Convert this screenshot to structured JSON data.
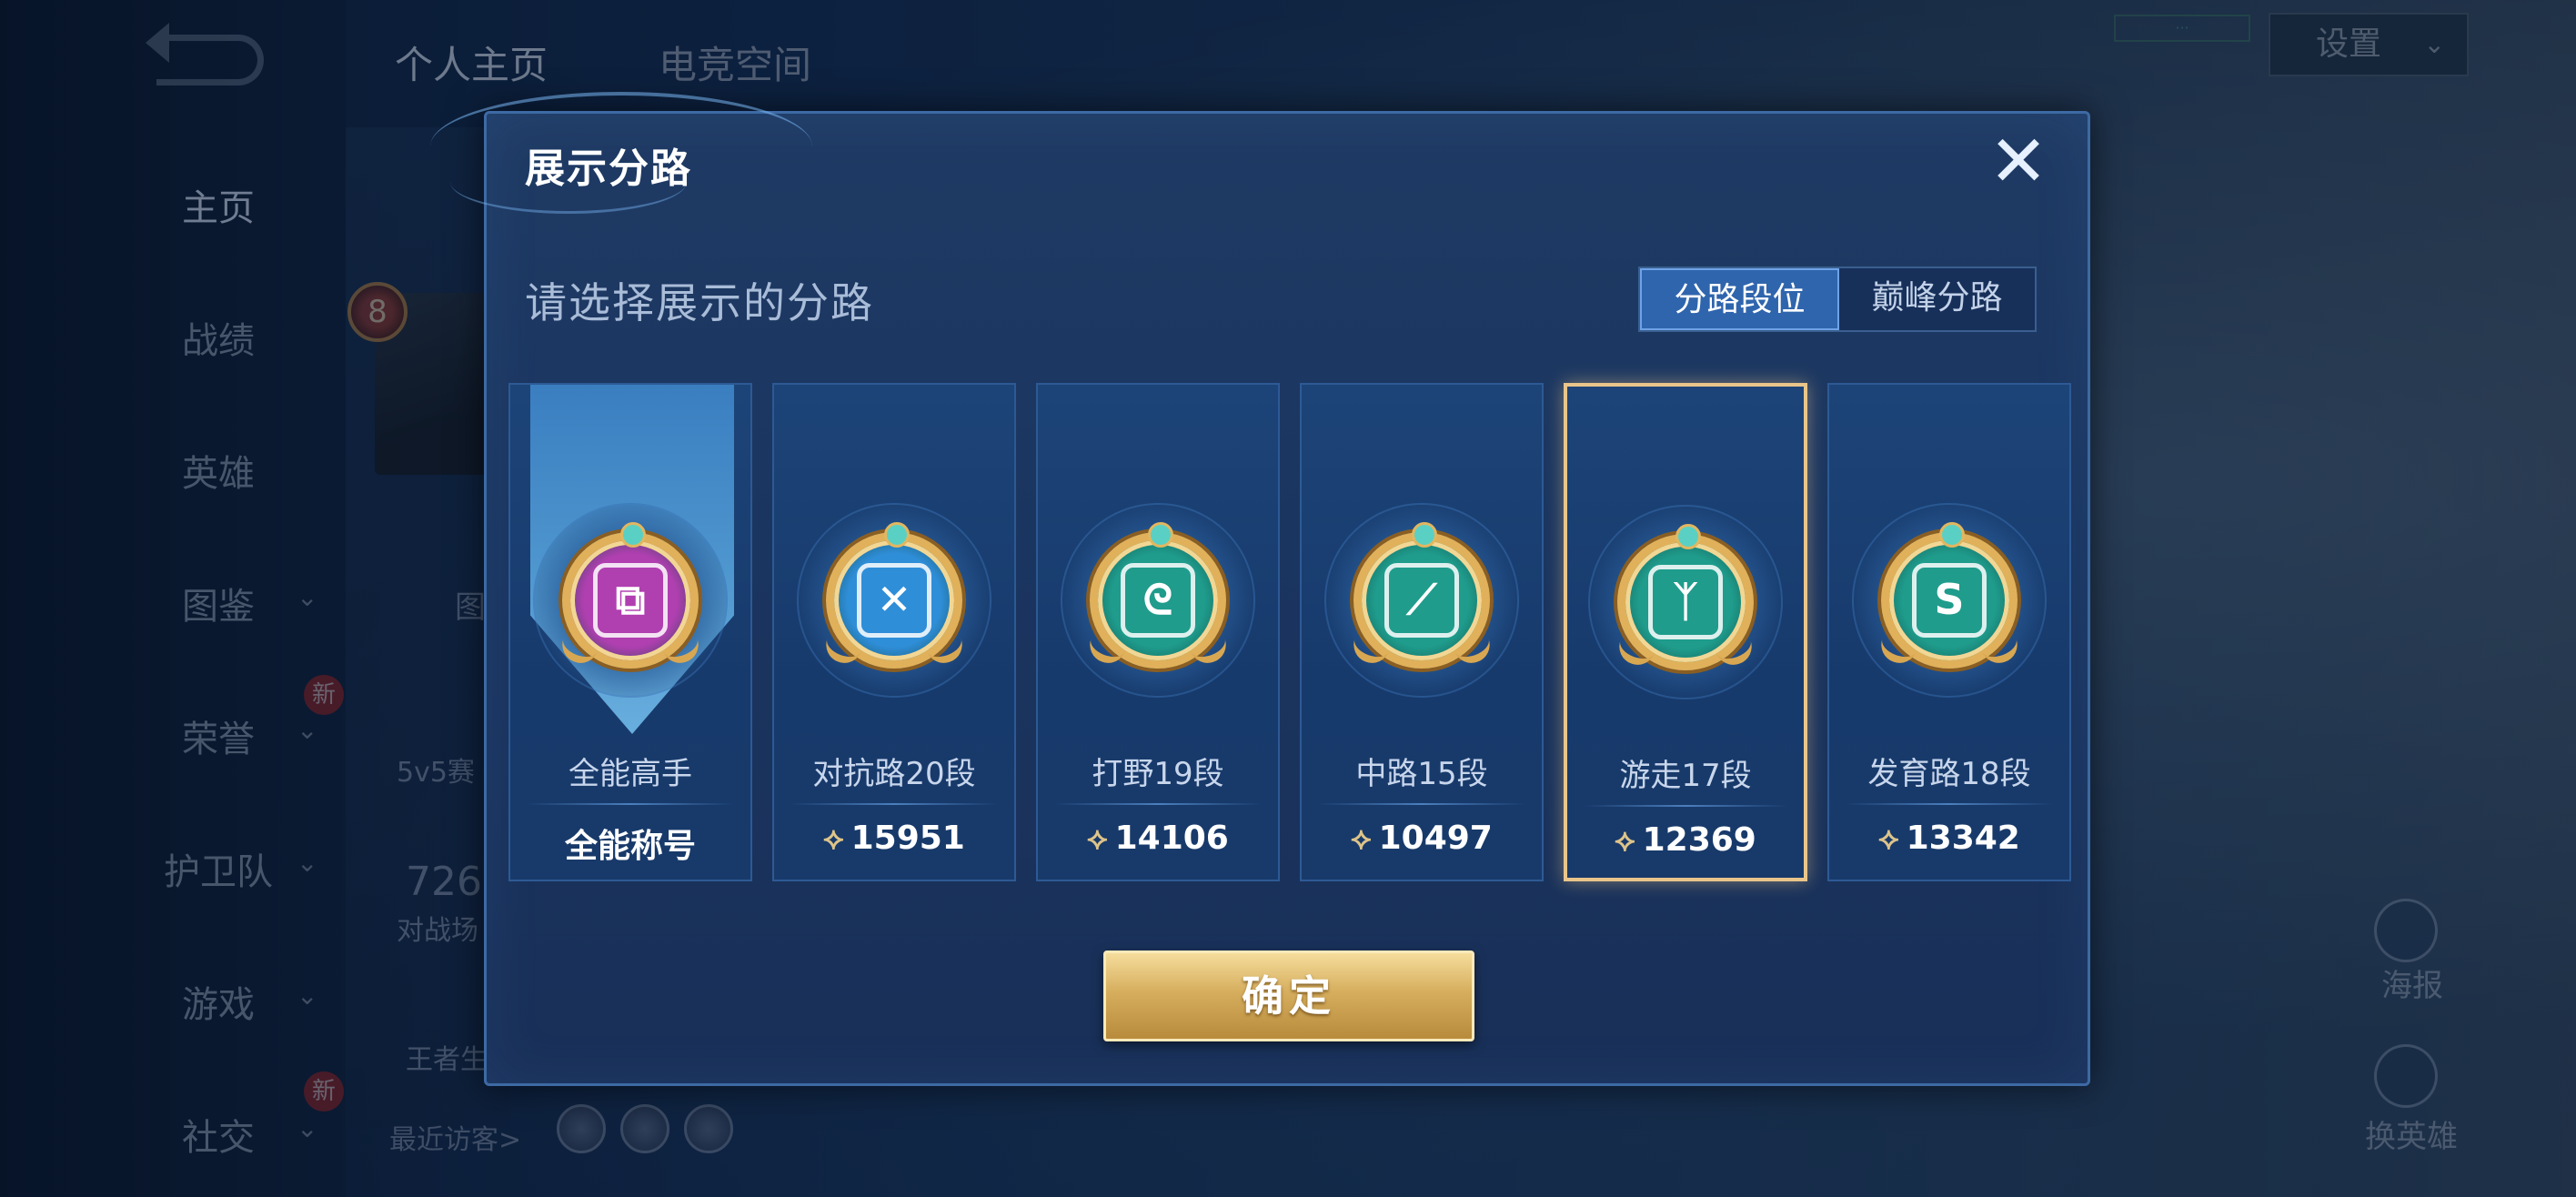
{
  "background": {
    "top_tabs": [
      "个人主页",
      "电竞空间"
    ],
    "nav_items": [
      {
        "label": "主页",
        "chevron": false
      },
      {
        "label": "战绩",
        "chevron": false
      },
      {
        "label": "英雄",
        "chevron": false
      },
      {
        "label": "图鉴",
        "chevron": true
      },
      {
        "label": "荣誉",
        "chevron": true,
        "badge": "新"
      },
      {
        "label": "护卫队",
        "chevron": true
      },
      {
        "label": "游戏",
        "chevron": true
      },
      {
        "label": "社交",
        "chevron": true,
        "badge": "新"
      }
    ],
    "level": "8",
    "fragments": [
      "图",
      "5v5赛",
      "726",
      "对战场",
      "王者生"
    ],
    "visitors_label": "最近访客>",
    "settings_label": "设置",
    "right_labels": [
      "海报",
      "换英雄"
    ]
  },
  "modal": {
    "title": "展示分路",
    "close_symbol": "✕",
    "subtitle": "请选择展示的分路",
    "toggle": {
      "options": [
        "分路段位",
        "巅峰分路"
      ],
      "active_index": 0
    },
    "cards": [
      {
        "name": "全能高手",
        "value": "全能称号",
        "emblem": "diamond-knot-icon",
        "emblem_color": "#b03fb0",
        "glyph": "⧉",
        "has_points_icon": false,
        "pennant": true
      },
      {
        "name": "对抗路20段",
        "value": "15951",
        "emblem": "crossed-swords-icon",
        "emblem_color": "#2f8ed8",
        "glyph": "✕",
        "has_points_icon": true
      },
      {
        "name": "打野19段",
        "value": "14106",
        "emblem": "dragon-icon",
        "emblem_color": "#1f9c8c",
        "glyph": "ᘓ",
        "has_points_icon": true
      },
      {
        "name": "中路15段",
        "value": "10497",
        "emblem": "slash-square-icon",
        "emblem_color": "#1f9c8c",
        "glyph": "⟋",
        "has_points_icon": true
      },
      {
        "name": "游走17段",
        "value": "12369",
        "emblem": "wings-icon",
        "emblem_color": "#1f9c8c",
        "glyph": "ᛉ",
        "has_points_icon": true,
        "selected": true
      },
      {
        "name": "发育路18段",
        "value": "13342",
        "emblem": "s-symbol-icon",
        "emblem_color": "#1f9c8c",
        "glyph": "S",
        "has_points_icon": true
      }
    ],
    "confirm_label": "确定"
  }
}
